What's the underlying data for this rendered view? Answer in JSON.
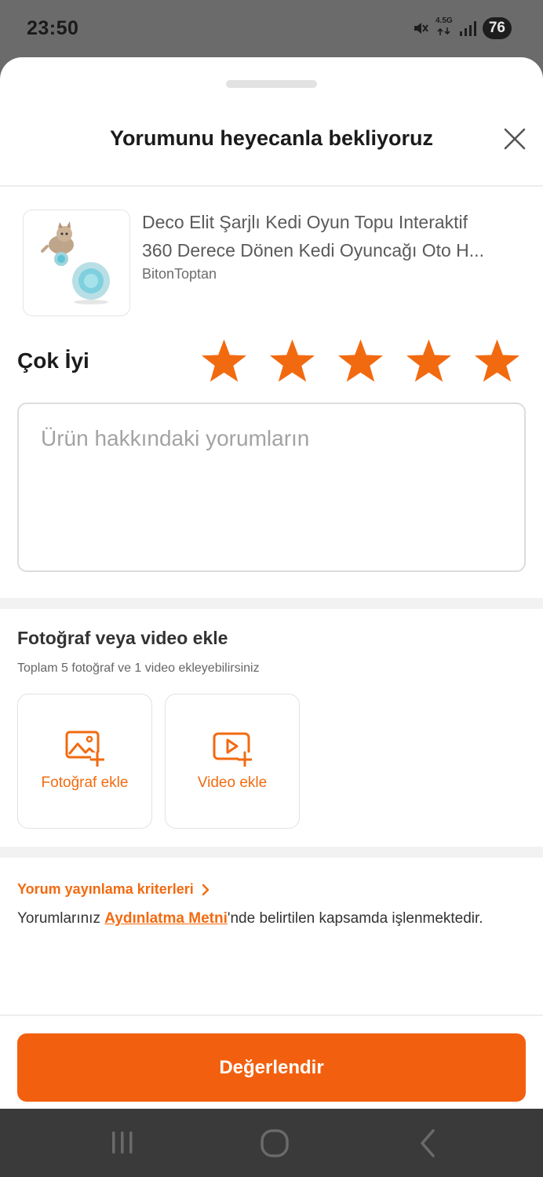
{
  "status_bar": {
    "time": "23:50",
    "network": "4.5G",
    "battery": "76"
  },
  "sheet": {
    "title": "Yorumunu heyecanla bekliyoruz"
  },
  "product": {
    "title_line1": "Deco Elit Şarjlı Kedi Oyun Topu Interaktif",
    "title_line2": "360 Derece Dönen Kedi Oyuncağı Oto H...",
    "seller": "BitonToptan"
  },
  "rating": {
    "label": "Çok İyi",
    "value": 5,
    "max": 5,
    "star_color": "#f26a10"
  },
  "comment": {
    "placeholder": "Ürün hakkındaki yorumların",
    "value": ""
  },
  "media": {
    "title": "Fotoğraf veya video ekle",
    "subtitle": "Toplam 5 fotoğraf ve 1 video ekleyebilirsiniz",
    "photo_label": "Fotoğraf ekle",
    "video_label": "Video ekle"
  },
  "info": {
    "criteria_link": "Yorum yayınlama kriterleri",
    "consent_prefix": "Yorumlarınız ",
    "consent_link": "Aydınlatma Metni",
    "consent_suffix": "'nde belirtilen kapsamda işlenmektedir."
  },
  "submit": {
    "label": "Değerlendir"
  },
  "colors": {
    "accent": "#f26a10",
    "nav_bar": "#3a3a3a"
  }
}
